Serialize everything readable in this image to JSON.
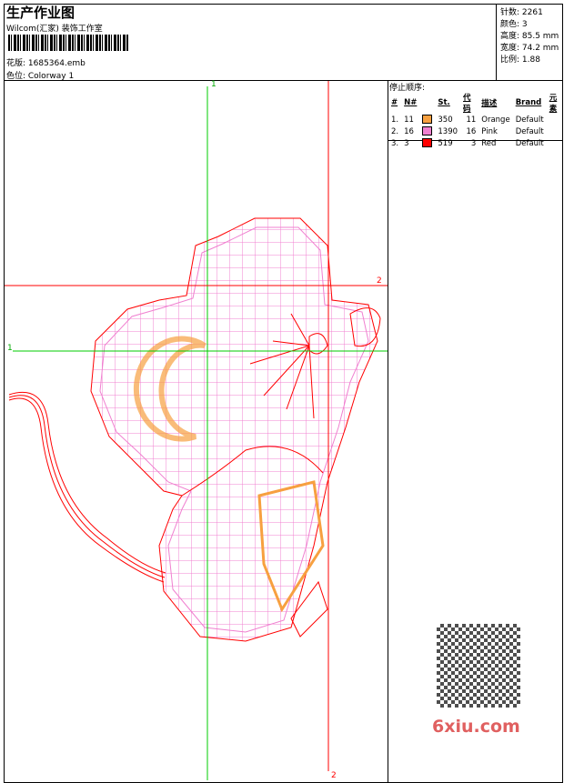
{
  "header": {
    "title": "生产作业图",
    "company": "Wilcom(汇家) 装饰工作室",
    "design_file": "花版: 1685364.emb",
    "colorway": "色位: Colorway 1"
  },
  "info": {
    "stitches": "针数: 2261",
    "colors": "颜色: 3",
    "height": "高度: 85.5 mm",
    "width": "宽度: 74.2 mm",
    "scale": "比例: 1.88"
  },
  "stop_sequence": {
    "title": "停止顺序:",
    "columns": [
      "#",
      "N#",
      "St.",
      "代码",
      "描述",
      "Brand",
      "元素"
    ],
    "rows": [
      {
        "idx": "1.",
        "n": "11",
        "color": "#f7a040",
        "st": "350",
        "code": "11",
        "desc": "Orange",
        "brand": "Default"
      },
      {
        "idx": "2.",
        "n": "16",
        "color": "#f080d0",
        "st": "1390",
        "code": "16",
        "desc": "Pink",
        "brand": "Default"
      },
      {
        "idx": "3.",
        "n": "3",
        "color": "#ff0000",
        "st": "519",
        "code": "3",
        "desc": "Red",
        "brand": "Default"
      }
    ]
  },
  "guides": {
    "v1": "1",
    "v2": "2",
    "h1": "1",
    "h2": "2"
  },
  "watermark": {
    "text": "6xiu.com"
  }
}
